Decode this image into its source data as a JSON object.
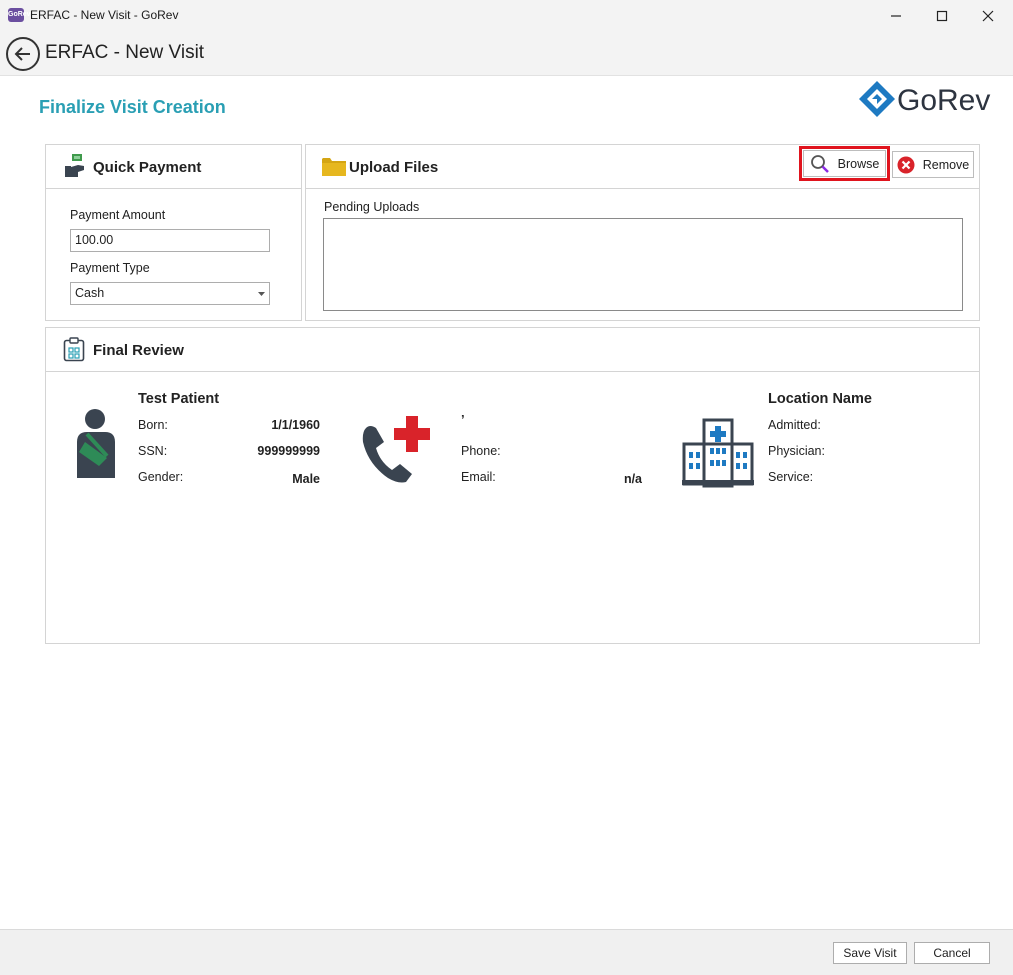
{
  "window": {
    "app_icon_text": "GoRev",
    "title": "ERFAC - New Visit - GoRev"
  },
  "header": {
    "title": "ERFAC - New Visit"
  },
  "page": {
    "title": "Finalize Visit Creation",
    "logo_text": "GoRev"
  },
  "quick_payment": {
    "title": "Quick Payment",
    "amount_label": "Payment Amount",
    "amount_value": "100.00",
    "type_label": "Payment Type",
    "type_value": "Cash"
  },
  "upload_files": {
    "title": "Upload Files",
    "browse_label": "Browse",
    "remove_label": "Remove",
    "pending_label": "Pending Uploads"
  },
  "final_review": {
    "title": "Final Review",
    "patient": {
      "name": "Test Patient",
      "born_label": "Born:",
      "born_value": "1/1/1960",
      "ssn_label": "SSN:",
      "ssn_value": "999999999",
      "gender_label": "Gender:",
      "gender_value": "Male"
    },
    "contact": {
      "address": "’",
      "phone_label": "Phone:",
      "phone_value": "",
      "email_label": "Email:",
      "email_value": "n/a"
    },
    "location": {
      "name": "Location Name",
      "admitted_label": "Admitted:",
      "physician_label": "Physician:",
      "service_label": "Service:"
    }
  },
  "footer": {
    "save_label": "Save Visit",
    "cancel_label": "Cancel"
  },
  "colors": {
    "accent": "#2a9fb4",
    "highlight": "#e0141e",
    "medical_red": "#d9232a",
    "icon_dark": "#3a4450",
    "folder": "#d4a514",
    "sling_green": "#2e8b57"
  }
}
